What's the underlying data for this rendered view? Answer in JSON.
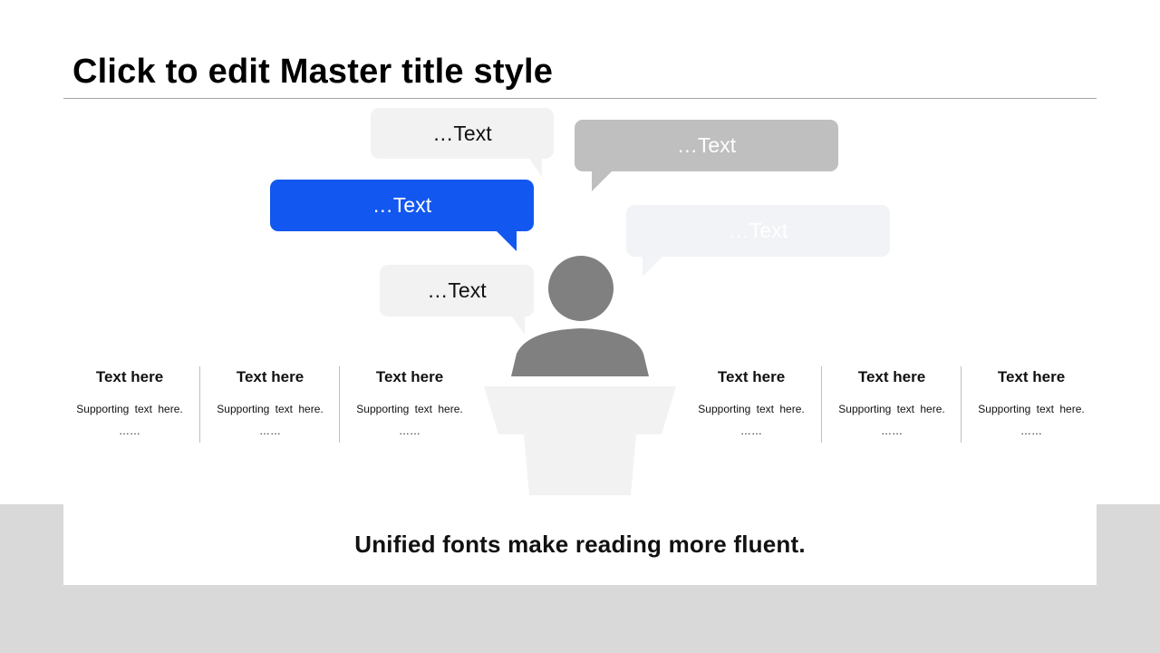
{
  "slide": {
    "title": "Click to edit Master title style",
    "footer": "Unified fonts make reading more fluent."
  },
  "bubbles": [
    {
      "text": "…Text",
      "fill": "#f2f2f2",
      "color": "#111111"
    },
    {
      "text": "…Text",
      "fill": "#bfbfbf",
      "color": "#ffffff"
    },
    {
      "text": "…Text",
      "fill": "#1257f0",
      "color": "#ffffff"
    },
    {
      "text": "…Text",
      "fill": "#f2f3f6",
      "color": "#ffffff"
    },
    {
      "text": "…Text",
      "fill": "#f2f2f2",
      "color": "#111111"
    }
  ],
  "columns_left": [
    {
      "title": "Text here",
      "support": "Supporting text here.",
      "ellipsis": "……"
    },
    {
      "title": "Text here",
      "support": "Supporting text here.",
      "ellipsis": "……"
    },
    {
      "title": "Text here",
      "support": "Supporting text here.",
      "ellipsis": "……"
    }
  ],
  "columns_right": [
    {
      "title": "Text here",
      "support": "Supporting text here.",
      "ellipsis": "……"
    },
    {
      "title": "Text here",
      "support": "Supporting text here.",
      "ellipsis": "……"
    },
    {
      "title": "Text here",
      "support": "Supporting text here.",
      "ellipsis": "……"
    }
  ],
  "colors": {
    "accent": "#1257f0",
    "speaker": "#808080",
    "podium": "#f2f2f2",
    "band": "#d9d9d9"
  },
  "icons": {
    "speaker": "person-speaker-icon",
    "podium": "podium-icon"
  }
}
